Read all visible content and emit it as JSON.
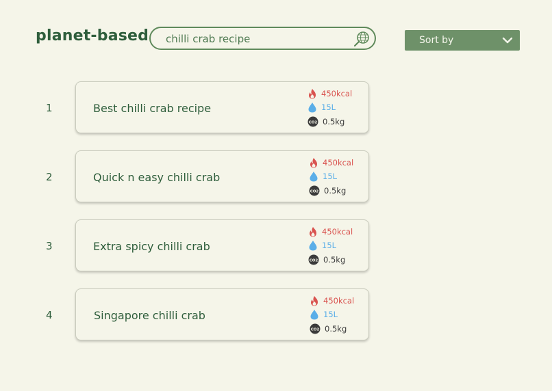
{
  "brand": {
    "name": "planet-based"
  },
  "search": {
    "value": "chilli crab recipe",
    "icon": "search-icon"
  },
  "sort": {
    "label": "Sort by",
    "icon": "chevron-down-icon"
  },
  "results": [
    {
      "rank": "1",
      "title": "Best chilli crab recipe",
      "calories": "450kcal",
      "water": "15L",
      "co2": "0.5kg"
    },
    {
      "rank": "2",
      "title": "Quick n easy chilli crab",
      "calories": "450kcal",
      "water": "15L",
      "co2": "0.5kg"
    },
    {
      "rank": "3",
      "title": "Extra spicy chilli crab",
      "calories": "450kcal",
      "water": "15L",
      "co2": "0.5kg"
    },
    {
      "rank": "4",
      "title": "Singapore chilli crab",
      "calories": "450kcal",
      "water": "15L",
      "co2": "0.5kg"
    }
  ],
  "icons": {
    "calories": "flame-icon",
    "water": "water-drop-icon",
    "co2": "co2-icon",
    "co2_badge_text": "CO2"
  },
  "colors": {
    "accent": "#2f5e3c",
    "sort_bg": "#6e9169",
    "calories": "#d9534f",
    "water": "#5aaee8",
    "co2": "#3a3a3a",
    "background": "#f5f5e9"
  }
}
